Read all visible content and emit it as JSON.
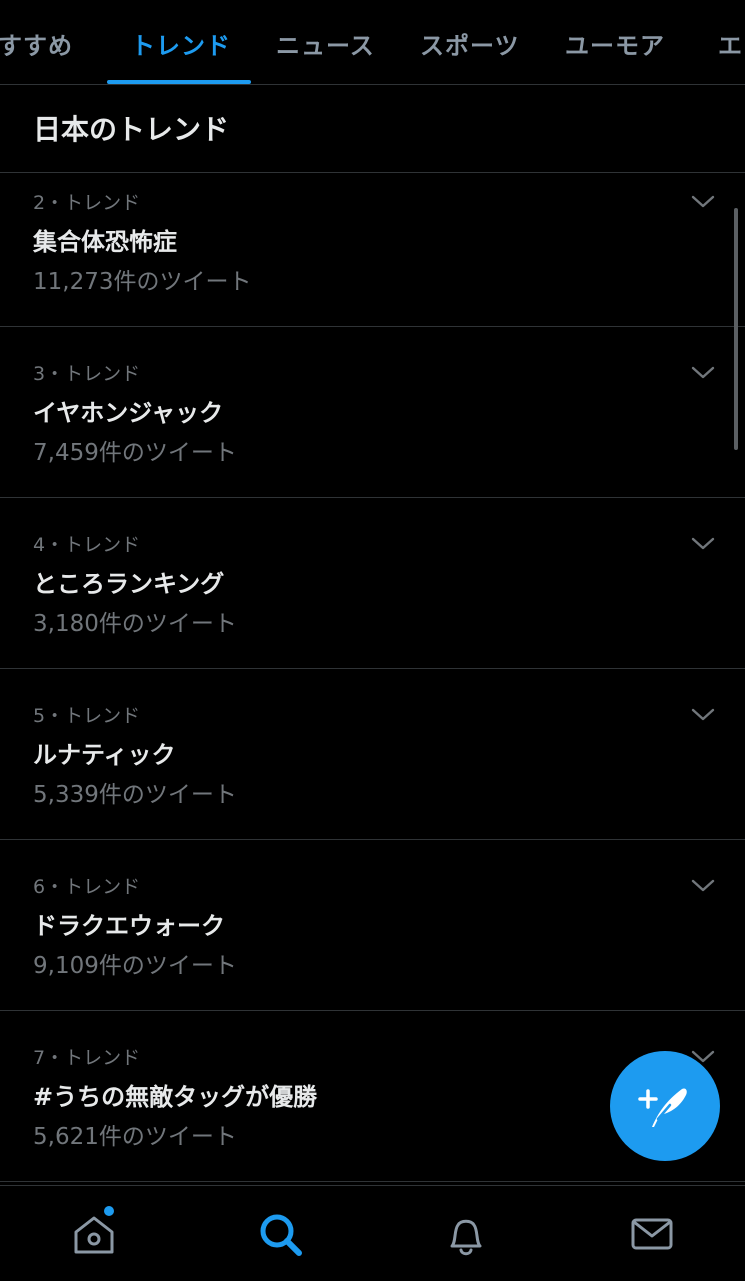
{
  "tabs": [
    {
      "label": "すすめ",
      "active": false
    },
    {
      "label": "トレンド",
      "active": true
    },
    {
      "label": "ニュース",
      "active": false
    },
    {
      "label": "スポーツ",
      "active": false
    },
    {
      "label": "ユーモア",
      "active": false
    },
    {
      "label": "エ",
      "active": false
    }
  ],
  "section": {
    "title": "日本のトレンド"
  },
  "trends": [
    {
      "meta": "2・トレンド",
      "name": "集合体恐怖症",
      "count": "11,273件のツイート"
    },
    {
      "meta": "3・トレンド",
      "name": "イヤホンジャック",
      "count": "7,459件のツイート"
    },
    {
      "meta": "4・トレンド",
      "name": "ところランキング",
      "count": "3,180件のツイート"
    },
    {
      "meta": "5・トレンド",
      "name": "ルナティック",
      "count": "5,339件のツイート"
    },
    {
      "meta": "6・トレンド",
      "name": "ドラクエウォーク",
      "count": "9,109件のツイート"
    },
    {
      "meta": "7・トレンド",
      "name": "#うちの無敵タッグが優勝",
      "count": "5,621件のツイート"
    }
  ],
  "bottom_nav": [
    {
      "icon": "home-icon",
      "active": false,
      "has_dot": true
    },
    {
      "icon": "search-icon",
      "active": true,
      "has_dot": false
    },
    {
      "icon": "bell-icon",
      "active": false,
      "has_dot": false
    },
    {
      "icon": "mail-icon",
      "active": false,
      "has_dot": false
    }
  ],
  "fab": {
    "icon": "compose-tweet-icon"
  },
  "colors": {
    "accent": "#1d9bf0",
    "background": "#000000",
    "divider": "#2f3336",
    "muted_text": "#71767b",
    "primary_text": "#e7e9ea"
  }
}
